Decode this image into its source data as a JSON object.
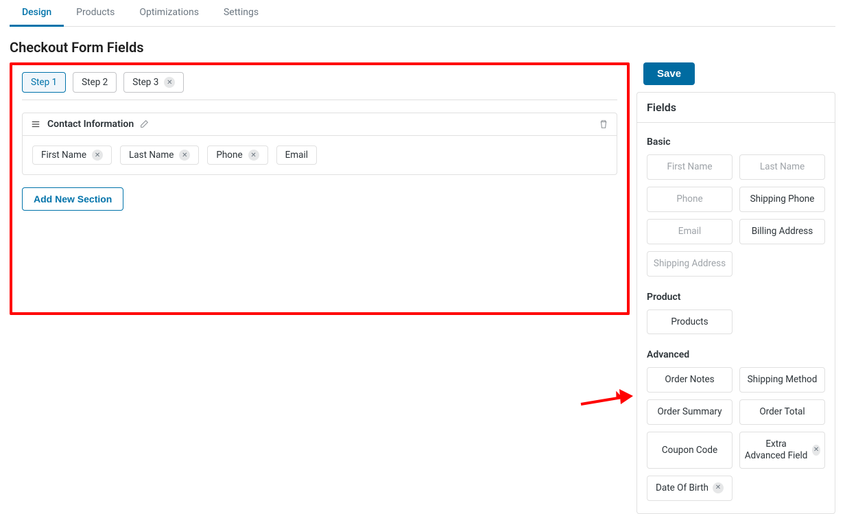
{
  "top_tabs": [
    "Design",
    "Products",
    "Optimizations",
    "Settings"
  ],
  "page_title": "Checkout Form Fields",
  "steps": [
    {
      "label": "Step 1",
      "removable": false
    },
    {
      "label": "Step 2",
      "removable": false
    },
    {
      "label": "Step 3",
      "removable": true
    }
  ],
  "save_label": "Save",
  "section": {
    "title": "Contact Information",
    "chips": [
      {
        "label": "First Name",
        "removable": true
      },
      {
        "label": "Last Name",
        "removable": true
      },
      {
        "label": "Phone",
        "removable": true
      },
      {
        "label": "Email",
        "removable": false
      }
    ]
  },
  "add_section_label": "Add New Section",
  "sidebar": {
    "title": "Fields",
    "groups": {
      "basic": {
        "title": "Basic",
        "items": [
          {
            "label": "First Name",
            "dim": true
          },
          {
            "label": "Last Name",
            "dim": true
          },
          {
            "label": "Phone",
            "dim": true
          },
          {
            "label": "Shipping Phone",
            "dim": false
          },
          {
            "label": "Email",
            "dim": true
          },
          {
            "label": "Billing Address",
            "dim": false
          },
          {
            "label": "Shipping Address",
            "dim": true
          }
        ]
      },
      "product": {
        "title": "Product",
        "items": [
          {
            "label": "Products"
          }
        ]
      },
      "advanced": {
        "title": "Advanced",
        "items": [
          {
            "label": "Order Notes"
          },
          {
            "label": "Shipping Method"
          },
          {
            "label": "Order Summary"
          },
          {
            "label": "Order Total"
          },
          {
            "label": "Coupon Code"
          },
          {
            "label": "Extra Advanced Field",
            "removable": true
          },
          {
            "label": "Date Of Birth",
            "removable": true
          }
        ]
      }
    }
  }
}
